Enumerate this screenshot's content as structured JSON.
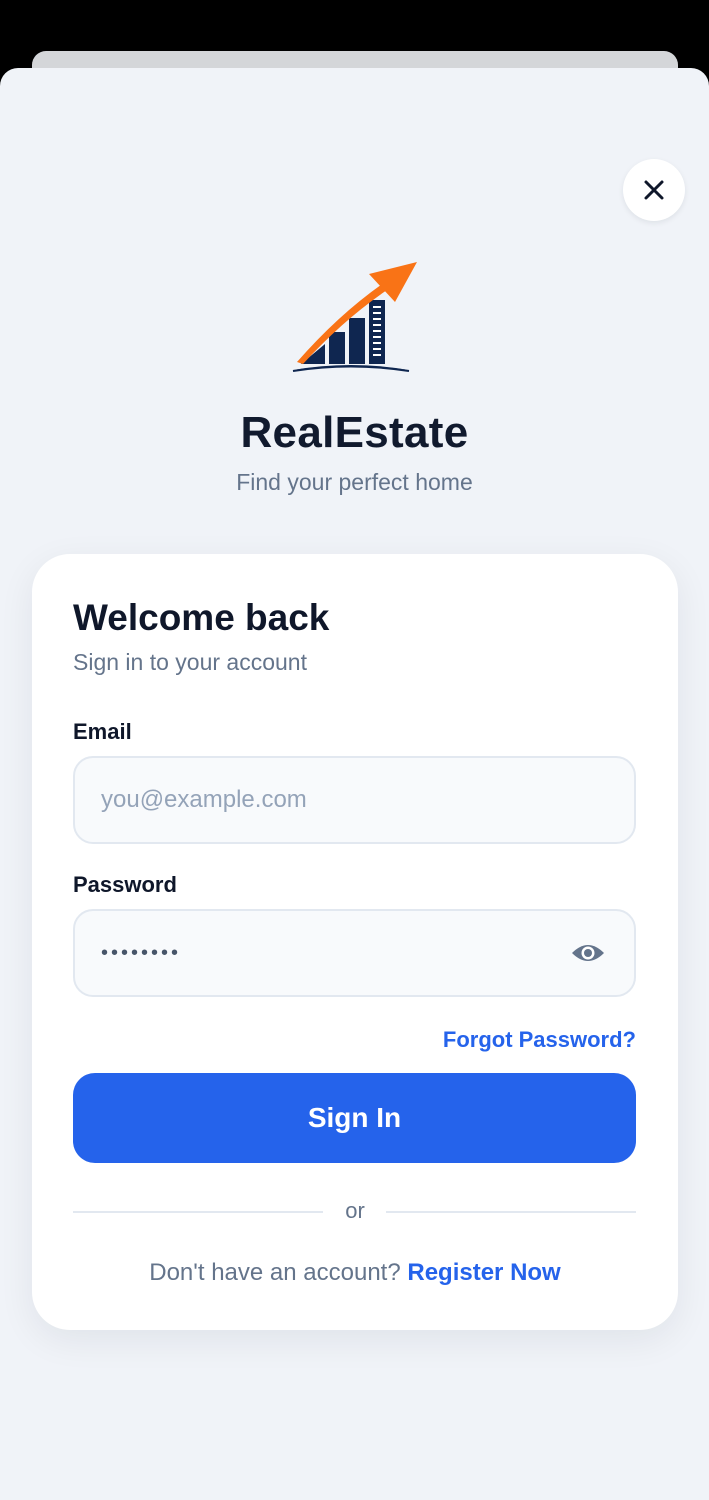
{
  "app": {
    "name": "RealEstate",
    "tagline": "Find your perfect home"
  },
  "icons": {
    "close": "close-icon",
    "logo": "rising-arrow-buildings-logo",
    "password_toggle": "eye-icon"
  },
  "colors": {
    "primary": "#2563eb",
    "logo_arrow": "#f97316",
    "logo_buildings": "#0f2650",
    "title_text": "#0f172a",
    "muted_text": "#64748b",
    "page_background": "#f0f3f8"
  },
  "login": {
    "title": "Welcome back",
    "subtitle": "Sign in to your account",
    "email": {
      "label": "Email",
      "placeholder": "you@example.com",
      "value": ""
    },
    "password": {
      "label": "Password",
      "masked_value": "••••••••"
    },
    "forgot_password": "Forgot Password?",
    "submit_label": "Sign In",
    "divider_text": "or",
    "register_prompt": "Don't have an account?",
    "register_link": "Register Now"
  }
}
